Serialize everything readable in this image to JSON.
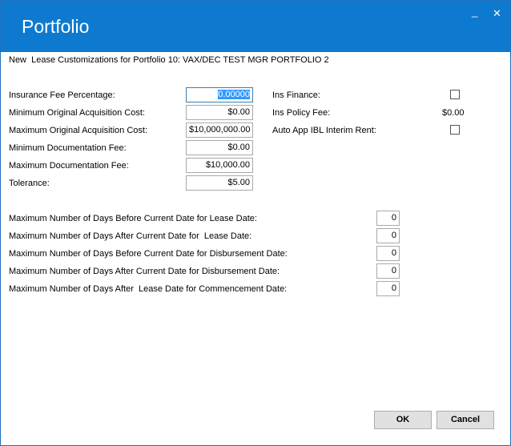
{
  "window": {
    "title": "Portfolio",
    "minimize_symbol": "_",
    "close_symbol": "✕",
    "title_bar_color": "#0d7ad0"
  },
  "header": {
    "text": "New  Lease Customizations for Portfolio 10: VAX/DEC TEST MGR PORTFOLIO 2"
  },
  "fees": [
    {
      "label": "Insurance Fee Percentage:",
      "value": "0.00000"
    },
    {
      "label": "Minimum Original Acquisition Cost:",
      "value": "$0.00"
    },
    {
      "label": "Maximum Original Acquisition Cost:",
      "value": "$10,000,000.00"
    },
    {
      "label": "Minimum Documentation Fee:",
      "value": "$0.00"
    },
    {
      "label": "Maximum Documentation Fee:",
      "value": "$10,000.00"
    },
    {
      "label": "Tolerance:",
      "value": "$5.00"
    }
  ],
  "right_fields": {
    "ins_finance_label": "Ins Finance:",
    "ins_finance_checked": false,
    "ins_policy_fee_label": "Ins Policy Fee:",
    "ins_policy_fee_value": "$0.00",
    "auto_app_label": "Auto App IBL Interim Rent:",
    "auto_app_checked": false
  },
  "days": [
    {
      "label": "Maximum Number of Days Before Current Date for Lease Date:",
      "value": "0"
    },
    {
      "label": "Maximum Number of Days After Current Date for  Lease Date:",
      "value": "0"
    },
    {
      "label": "Maximum Number of Days Before Current Date for Disbursement Date:",
      "value": "0"
    },
    {
      "label": "Maximum Number of Days After Current Date for Disbursement Date:",
      "value": "0"
    },
    {
      "label": "Maximum Number of Days After  Lease Date for Commencement Date:",
      "value": "0"
    }
  ],
  "buttons": {
    "ok": "OK",
    "cancel": "Cancel"
  }
}
